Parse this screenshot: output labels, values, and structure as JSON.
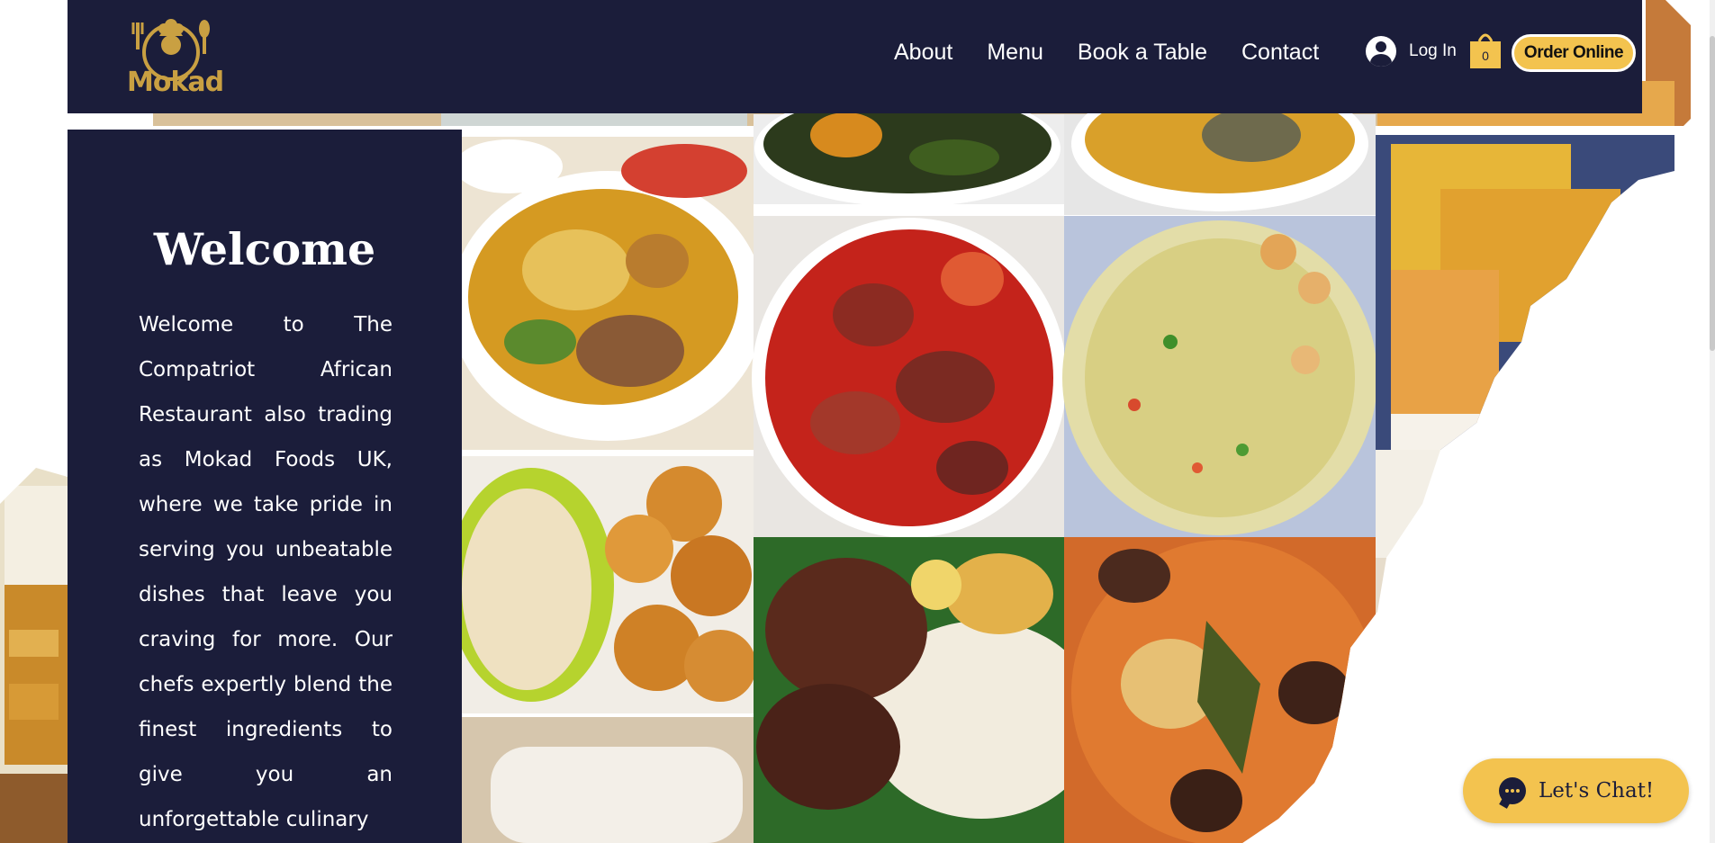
{
  "header": {
    "logo_text": "Mokad",
    "nav": [
      "About",
      "Menu",
      "Book a Table",
      "Contact"
    ],
    "login_label": "Log In",
    "cart_count": "0",
    "order_label": "Order Online"
  },
  "welcome": {
    "title": "Welcome",
    "body": "Welcome to The Compatriot African Restaurant also trading as Mokad Foods UK, where we take pride in serving you unbeatable dishes that leave you craving for more. Our chefs expertly blend the finest ingredients to give you an unforgettable culinary"
  },
  "chat": {
    "label": "Let's Chat!"
  },
  "colors": {
    "navy": "#1b1d3a",
    "gold": "#f3c34f",
    "logo_gold": "#c9a042"
  },
  "images": [
    "vegetable-soup-with-tripe",
    "ogbono-vegetable-soup",
    "egusi-soup-bowl",
    "moi-moi-slices",
    "fufu-and-puff-puff",
    "red-stew-with-meat",
    "fried-rice",
    "ofada-rice-with-stew",
    "jollof-rice-with-beef",
    "pounded-yam",
    "white-rice-side",
    "fried-plantain-side"
  ]
}
